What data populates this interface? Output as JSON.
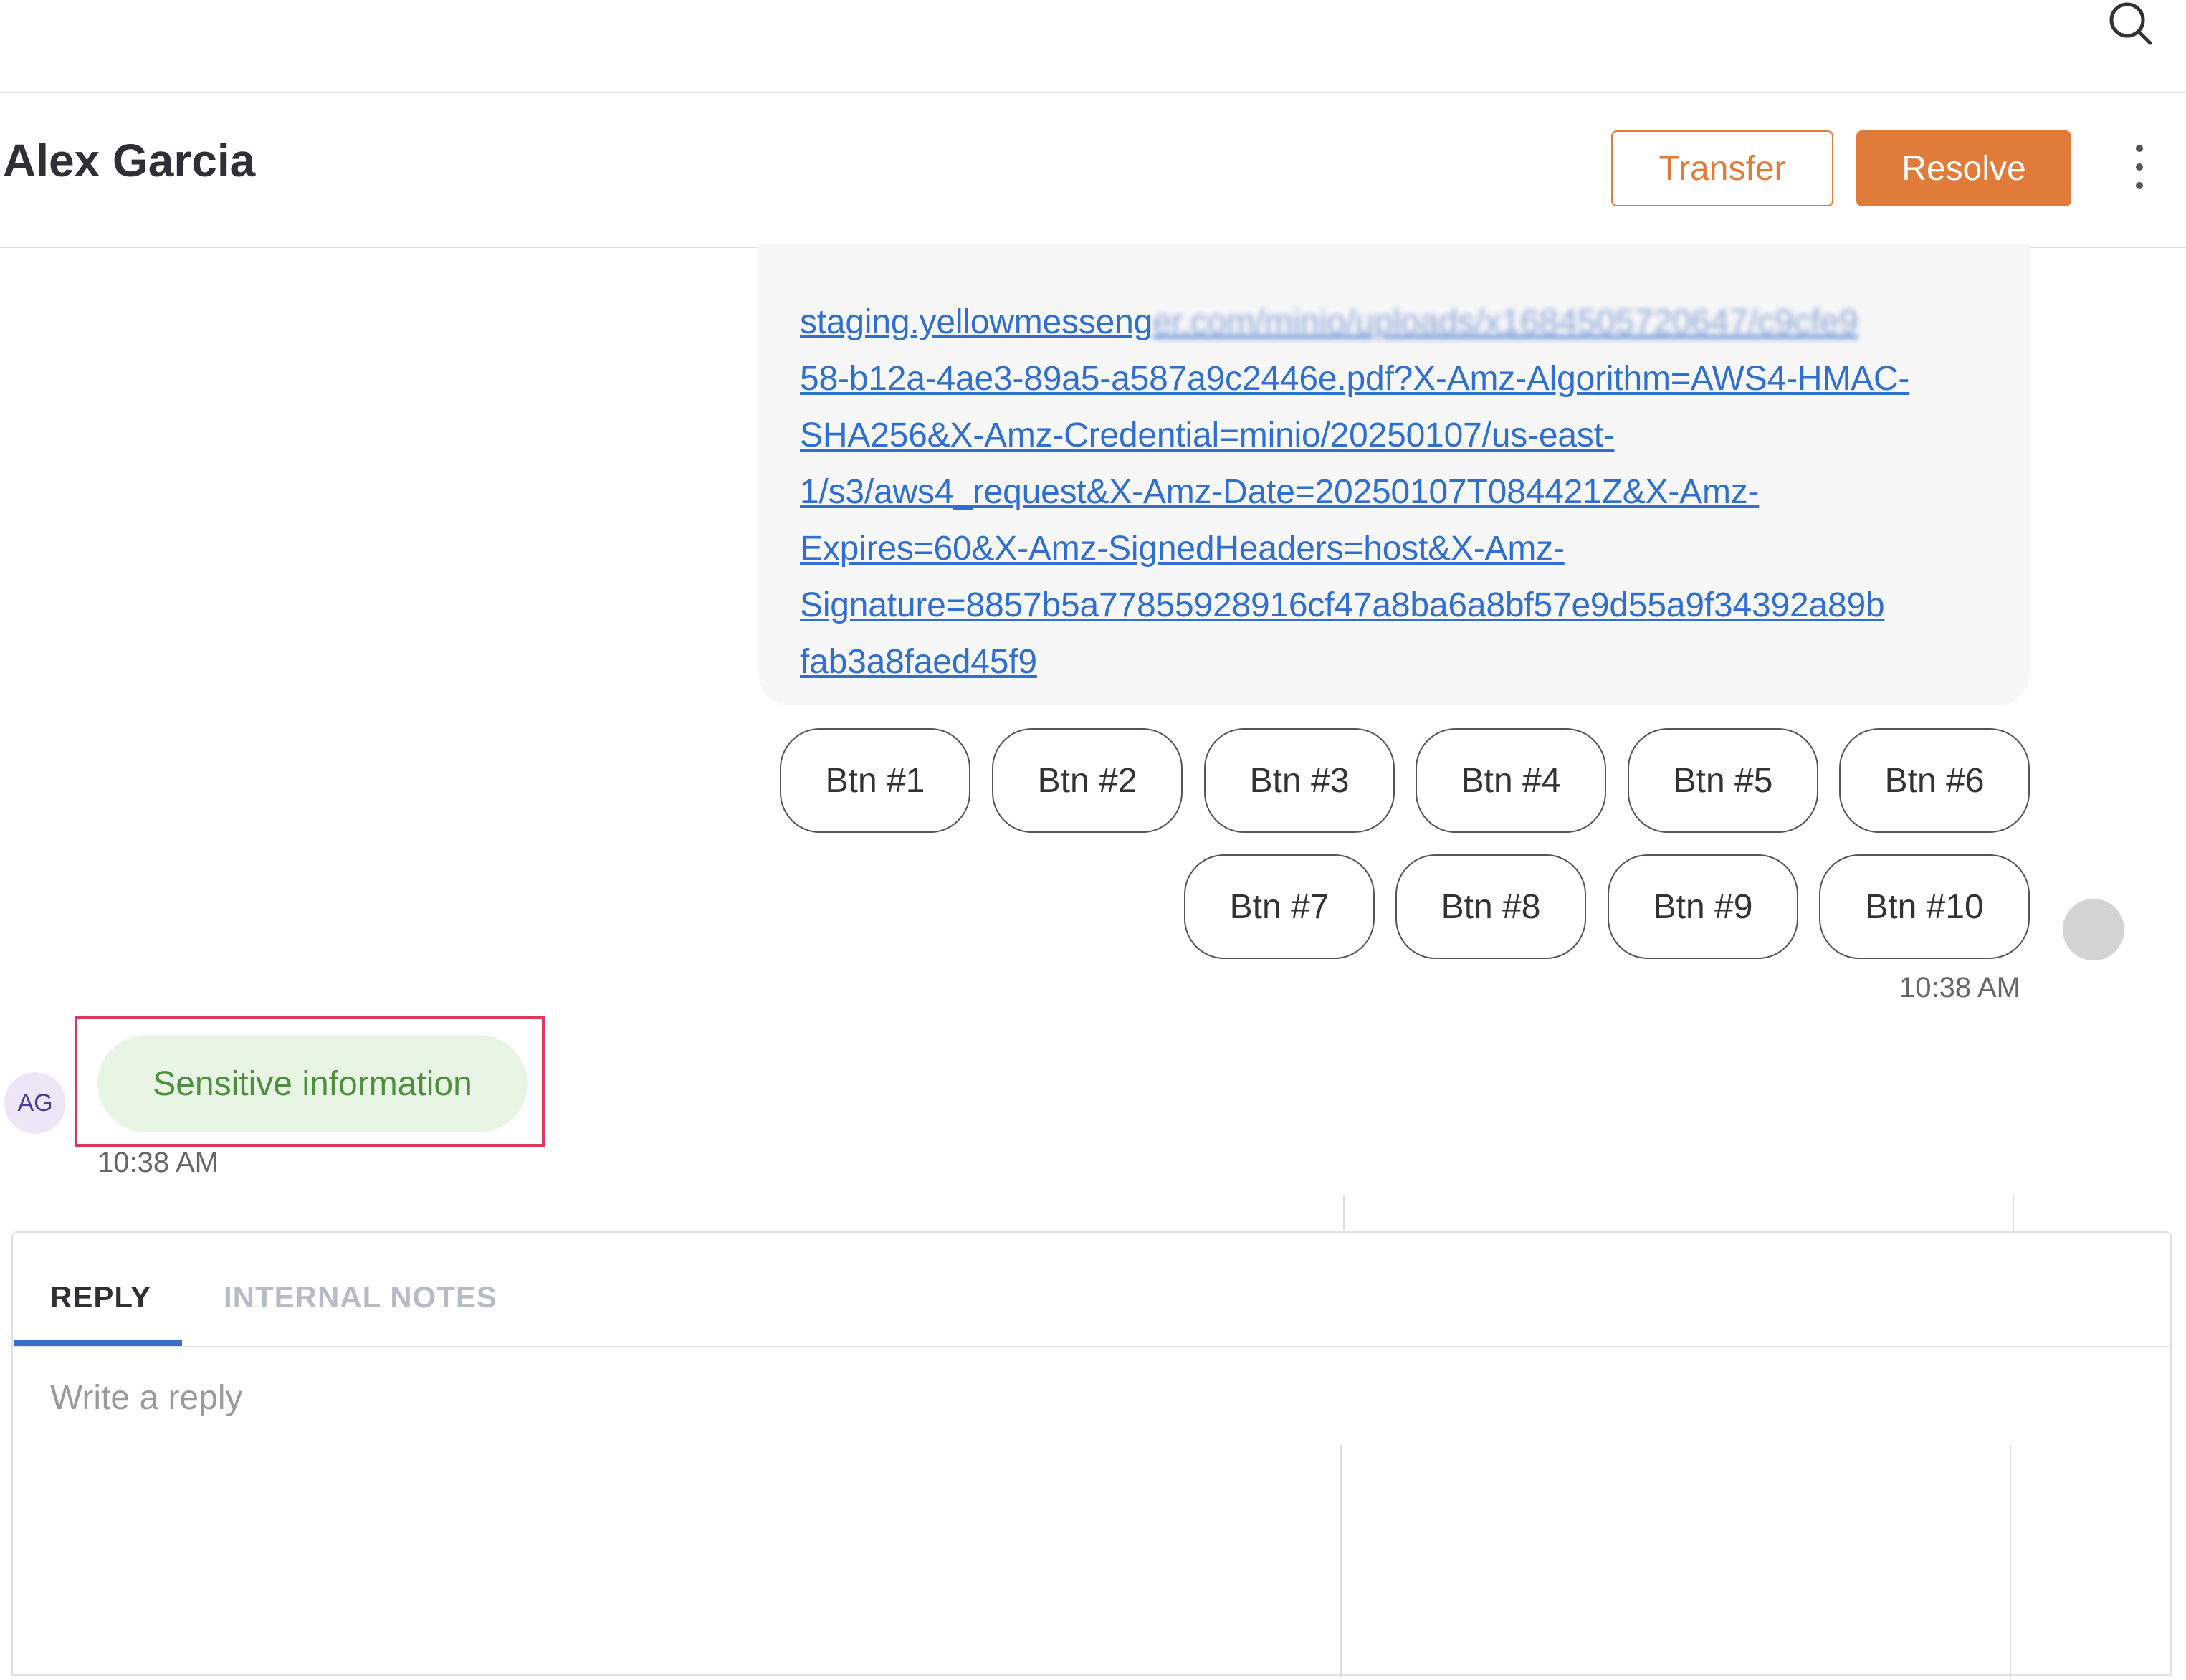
{
  "header": {
    "contact_name": "Alex Garcia",
    "transfer_label": "Transfer",
    "resolve_label": "Resolve"
  },
  "bot_message": {
    "link_lines": [
      "staging.yellowmesseng",
      "58-b12a-4ae3-89a5-a587a9c2446e.pdf?X-Amz-Algorithm=AWS4-HMAC-",
      "SHA256&X-Amz-Credential=minio/20250107/us-east-",
      "1/s3/aws4_request&X-Amz-Date=20250107T084421Z&X-Amz-",
      "Expires=60&X-Amz-SignedHeaders=host&X-Amz-",
      "Signature=8857b5a77855928916cf47a8ba6a8bf57e9d55a9f34392a89b",
      "fab3a8faed45f9"
    ],
    "link_blurred_part": "er.com/minio/uploads/x1684505720647/c9cfe9",
    "quick_replies": [
      "Btn #1",
      "Btn #2",
      "Btn #3",
      "Btn #4",
      "Btn #5",
      "Btn #6",
      "Btn #7",
      "Btn #8",
      "Btn #9",
      "Btn #10"
    ],
    "time": "10:38 AM"
  },
  "user_message": {
    "avatar_initials": "AG",
    "text": "Sensitive information",
    "time": "10:38 AM"
  },
  "composer": {
    "tabs": [
      "REPLY",
      "INTERNAL NOTES"
    ],
    "active_tab": "REPLY",
    "placeholder": "Write a reply"
  },
  "colors": {
    "accent": "#e07b39",
    "link": "#2f6fcf",
    "highlight_border": "#e0385c",
    "user_bubble": "#e9f5e4",
    "tab_active": "#3b6cc7"
  }
}
